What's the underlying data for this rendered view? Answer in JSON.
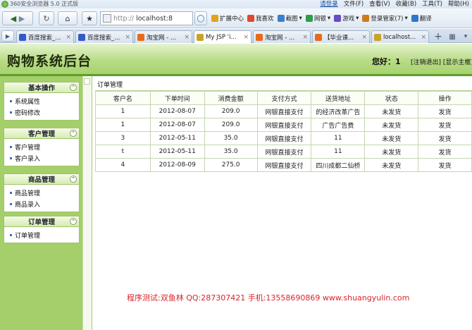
{
  "browser": {
    "app_title": "360安全浏览器 5.0 正式版",
    "menu": [
      "请登录",
      "文件(F)",
      "查看(V)",
      "收藏(B)",
      "工具(T)",
      "帮助(H)"
    ],
    "url_proto": "http://",
    "url": "localhost:8",
    "toolbar_items": [
      {
        "label": "扩展中心",
        "color": "#e2a21c"
      },
      {
        "label": "我喜欢",
        "color": "#e2462f"
      },
      {
        "label": "截图",
        "color": "#3a7fd0"
      },
      {
        "label": "网银",
        "color": "#2f9c4a"
      },
      {
        "label": "游戏",
        "color": "#6a4bc4"
      },
      {
        "label": "登录管家(7)",
        "color": "#d07a1f"
      },
      {
        "label": "翻译",
        "color": "#2f77c9"
      }
    ],
    "tabs": [
      {
        "label": "百度搜索_...",
        "color": "#3559c9",
        "active": false
      },
      {
        "label": "百度搜索_...",
        "color": "#3559c9",
        "active": false
      },
      {
        "label": "淘宝网 - ...",
        "color": "#e86a1a",
        "active": false
      },
      {
        "label": "My JSP 'i...",
        "color": "#c9a227",
        "active": true
      },
      {
        "label": "淘宝网 - ...",
        "color": "#e86a1a",
        "active": false
      },
      {
        "label": "【毕业课...",
        "color": "#e86a1a",
        "active": false
      },
      {
        "label": "localhost...",
        "color": "#c9a227",
        "active": false
      }
    ]
  },
  "header": {
    "brand": "购物系统后台",
    "greeting": "您好：1",
    "links": "[注销退出] [显示主框]"
  },
  "sidebar": {
    "panels": [
      {
        "title": "基本操作",
        "items": [
          "系统属性",
          "密码修改"
        ]
      },
      {
        "title": "客户管理",
        "items": [
          "客户管理",
          "客户录入"
        ]
      },
      {
        "title": "商品管理",
        "items": [
          "商品管理",
          "商品录入"
        ]
      },
      {
        "title": "订单管理",
        "items": [
          "订单管理"
        ]
      }
    ]
  },
  "orders": {
    "caption": "订单管理",
    "columns": [
      "客户名",
      "下单时间",
      "消费金额",
      "支付方式",
      "送货地址",
      "状态",
      "操作"
    ],
    "rows": [
      [
        "1",
        "2012-08-07",
        "209.0",
        "网银直接支付",
        "的经济改革广告",
        "未发货",
        "发货"
      ],
      [
        "1",
        "2012-08-07",
        "209.0",
        "网银直接支付",
        "广告广告费",
        "未发货",
        "发货"
      ],
      [
        "3",
        "2012-05-11",
        "35.0",
        "网银直接支付",
        "11",
        "未发货",
        "发货"
      ],
      [
        "t",
        "2012-05-11",
        "35.0",
        "网银直接支付",
        "11",
        "未发货",
        "发货"
      ],
      [
        "4",
        "2012-08-09",
        "275.0",
        "网银直接支付",
        "四川成都二仙桥",
        "未发货",
        "发货"
      ]
    ]
  },
  "footer_note": "程序测试:双鱼林 QQ:287307421 手机:13558690869 www.shuangyulin.com"
}
